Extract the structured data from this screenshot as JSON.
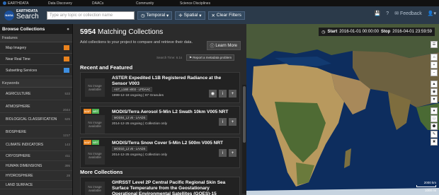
{
  "topnav": {
    "brand": "EARTHDATA",
    "menu": [
      "Data Discovery",
      "DAACs",
      "Community",
      "Science Disciplines"
    ]
  },
  "header": {
    "logo_line1": "EARTHDATA",
    "logo_line2": "Search",
    "nasa_badge": "NASA",
    "search_placeholder": "Type any topic or collection name",
    "temporal_label": "Temporal",
    "spatial_label": "Spatial",
    "clear_filters_label": "Clear Filters",
    "feedback_label": "Feedback"
  },
  "sidebar": {
    "title": "Browse Collections",
    "features_label": "Features",
    "features": [
      {
        "label": "Map Imagery",
        "icon": "map-imagery-icon",
        "color": "#e8821e"
      },
      {
        "label": "Near Real Time",
        "icon": "nrt-icon",
        "color": "#e8821e"
      },
      {
        "label": "Subsetting Services",
        "icon": "subsetting-icon",
        "color": "#3d8ee0"
      }
    ],
    "keywords_label": "Keywords",
    "keywords": [
      {
        "label": "AGRICULTURE",
        "count": "533"
      },
      {
        "label": "ATMOSPHERE",
        "count": "2044"
      },
      {
        "label": "BIOLOGICAL CLASSIFICATION",
        "count": "625"
      },
      {
        "label": "BIOSPHERE",
        "count": "1217"
      },
      {
        "label": "CLIMATE INDICATORS",
        "count": "143"
      },
      {
        "label": "CRYOSPHERE",
        "count": "411"
      },
      {
        "label": "HUMAN DIMENSIONS",
        "count": "395"
      },
      {
        "label": "HYDROSPHERE",
        "count": "28"
      },
      {
        "label": "LAND SURFACE",
        "count": ""
      }
    ]
  },
  "panel": {
    "count": "5954",
    "title_suffix": "Matching Collections",
    "subtitle": "Add collections to your project to compare and retrieve their data.",
    "learn_more": "Learn More",
    "search_time": "Search Time: 6.1s",
    "report_label": "Report a metadata problem",
    "recent_heading": "Recent and Featured",
    "more_heading": "More Collections",
    "no_image": "No image available",
    "cards": [
      {
        "title": "ASTER Expedited L1B Registered Radiance at the Sensor V003",
        "tag": "AST_L1BE v003 - LPDAAC",
        "meta": "1999-12-18 ongoing | 87 Granules"
      },
      {
        "title": "MODIS/Terra Aerosol 5-Min L2 Swath 10km V005 NRT",
        "tag": "MOD04_L2 v5 - LAADS",
        "meta": "2014-12-25 ongoing | Collection only"
      },
      {
        "title": "MODIS/Terra Snow Cover 5-Min L2 500m V005 NRT",
        "tag": "MOD10_L2 v5 - LAADS",
        "meta": "2014-12-25 ongoing | Collection only"
      },
      {
        "title": "GHRSST Level 2P Central Pacific Regional Skin Sea Surface Temperature from the Geostationary Operational Environmental Satellites (GOES)-15"
      }
    ],
    "badge_map": "MAP",
    "badge_nrt": "NRT"
  },
  "map": {
    "start_label": "Start",
    "start_value": "2016-01-01 00:00:00",
    "stop_label": "Stop",
    "stop_value": "2016-04-01 23:59:59",
    "scale_km": "2000 km",
    "scale_mi": "1000 mi"
  }
}
